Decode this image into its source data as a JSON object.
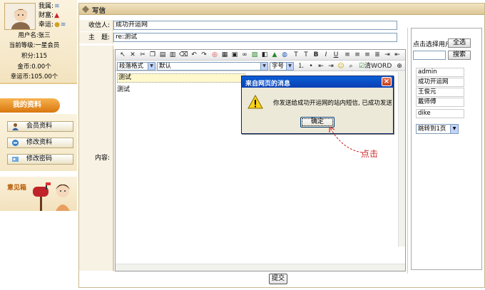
{
  "sidebar": {
    "stats": [
      {
        "label": "我属",
        "symbol": "≋",
        "color": "#4a78c0"
      },
      {
        "label": "财富",
        "symbol": "▲",
        "color": "#cc2222"
      },
      {
        "label": "幸运",
        "symbol": "●≋",
        "color": "#d4a020"
      }
    ],
    "username_line": "用户名:张三",
    "level_line": "当前等级:一星会员",
    "points_line": "积分:115",
    "gold_line": "金币:0.00个",
    "luck_line": "幸运币:105.00个",
    "my_info_title": "我的资料",
    "menu": [
      {
        "label": "会员资料",
        "icon": "member-icon"
      },
      {
        "label": "修改资料",
        "icon": "edit-icon"
      },
      {
        "label": "修改密码",
        "icon": "key-icon"
      }
    ],
    "suggest_label": "意见箱"
  },
  "page": {
    "title": "写信"
  },
  "form": {
    "recipient_label": "收信人:",
    "recipient_value": "成功开运网",
    "subject_label": "主　题:",
    "subject_value": "re:测试",
    "content_label": "内容:",
    "editor": {
      "paragraph_format": "段落格式",
      "font_name": "默认",
      "font_size": "字号",
      "clear_word_label": "清WORD",
      "line1": "测试",
      "line2": "测试"
    },
    "submit_label": "提交"
  },
  "user_panel": {
    "choose_label": "点击选择用户",
    "select_all_label": "全选",
    "search_placeholder": "",
    "search_label": "搜索",
    "users": [
      "admin",
      "成功开运网",
      "王俊元",
      "戴师傅",
      "dike"
    ],
    "page_jump_value": "跳转到1页"
  },
  "dialog": {
    "title": "来自网页的消息",
    "message": "你发送给成功开运网的站内短信, 已成功发送",
    "ok_label": "确定",
    "icon": "warning-icon"
  },
  "annotation": {
    "text": "点击",
    "color": "#cc2a2a"
  }
}
